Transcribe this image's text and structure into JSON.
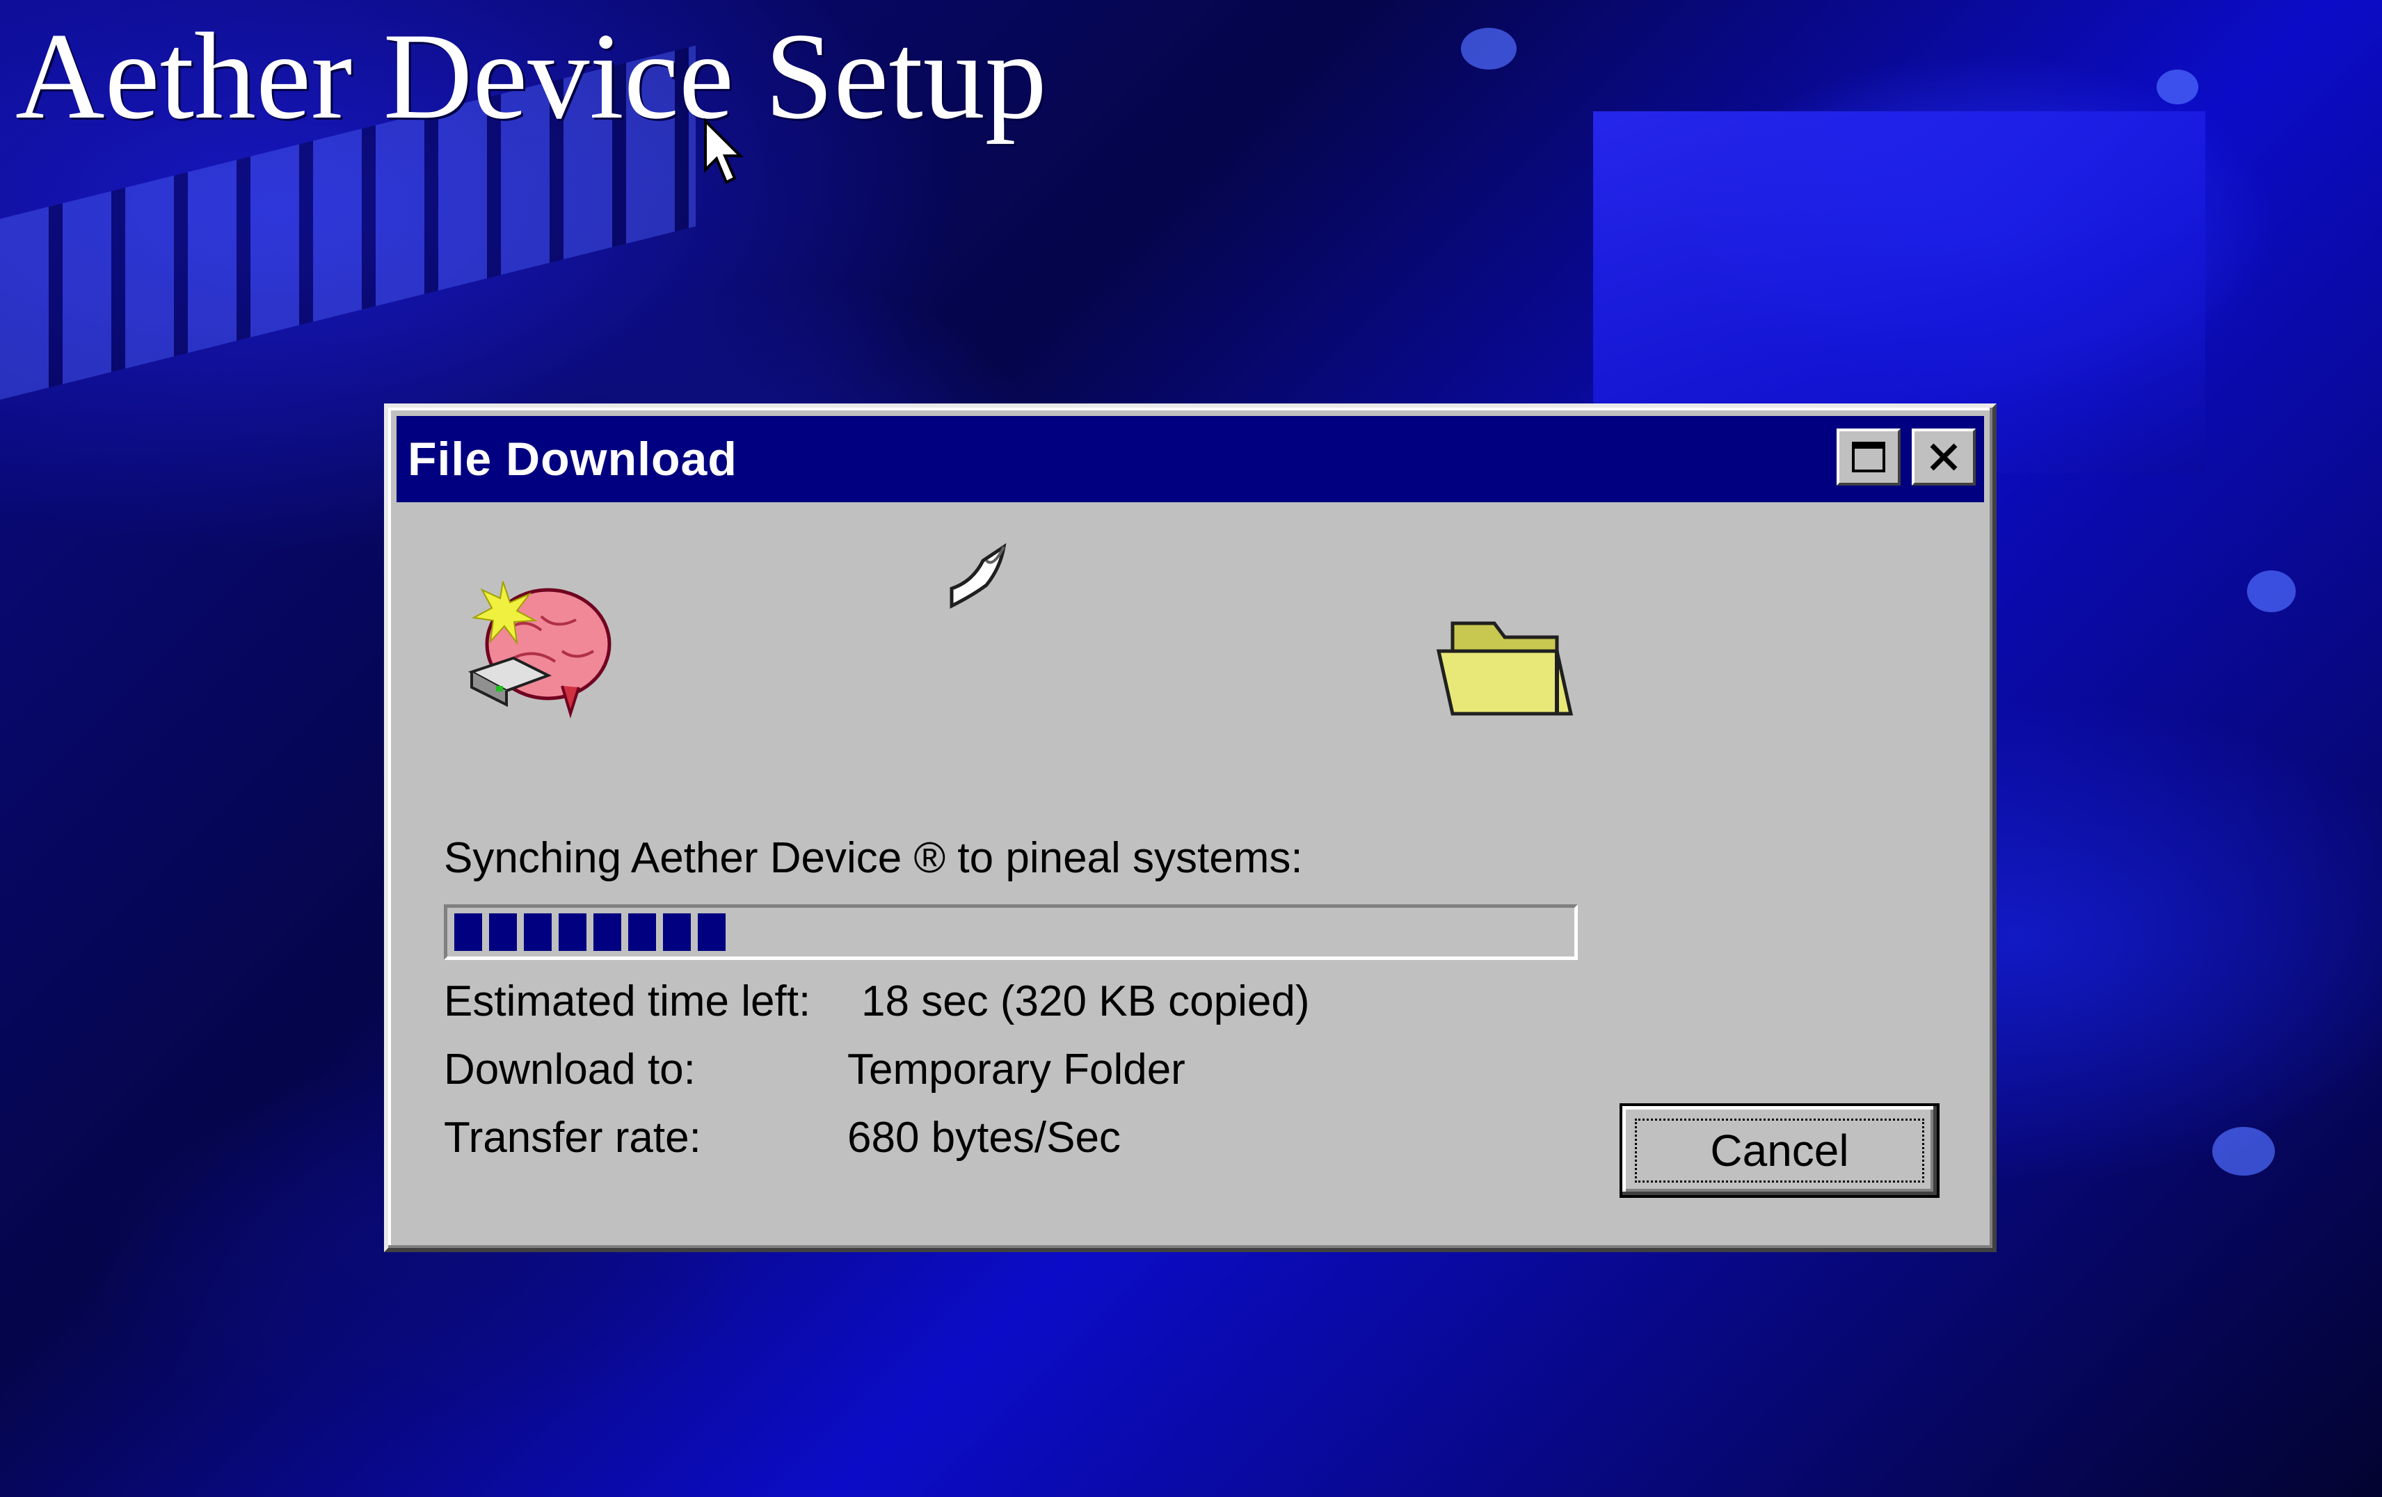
{
  "desktop": {
    "title": "Aether Device Setup"
  },
  "dialog": {
    "title": "File Download",
    "status_label": "Synching Aether Device ® to pineal systems:",
    "progress_fraction": 0.27,
    "rows": [
      {
        "label": "Estimated time left:",
        "value": "18 sec (320 KB copied)"
      },
      {
        "label": "Download to:",
        "value": "Temporary Folder"
      },
      {
        "label": "Transfer rate:",
        "value": "680 bytes/Sec"
      }
    ],
    "cancel_label": "Cancel"
  },
  "colors": {
    "titlebar": "#000080",
    "window": "#c0c0c0",
    "progress": "#000080"
  },
  "icons": {
    "source": "brain-icon",
    "flying": "paper-icon",
    "destination": "folder-icon",
    "maximize": "maximize-icon",
    "close": "close-icon",
    "cursor": "mouse-cursor-icon"
  }
}
